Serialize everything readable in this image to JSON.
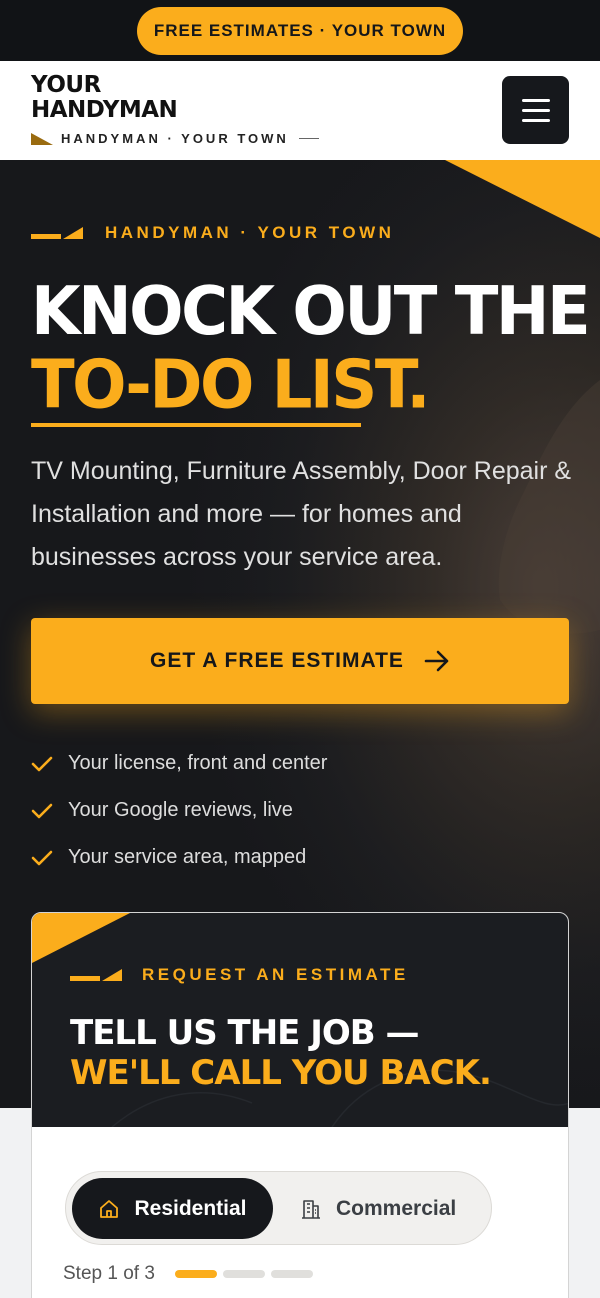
{
  "announcement": {
    "label": "FREE ESTIMATES · YOUR TOWN"
  },
  "brand": {
    "line1": "YOUR",
    "line2": "HANDYMAN",
    "tagline": "HANDYMAN · YOUR TOWN"
  },
  "menu": {
    "icon": "hamburger-menu-icon"
  },
  "hero": {
    "eyebrow": "HANDYMAN · YOUR TOWN",
    "title_line1": "KNOCK OUT THE",
    "title_line2": "TO-DO LIST.",
    "lead": "TV Mounting, Furniture Assembly, Door Repair & Installation and more — for homes and businesses across your service area.",
    "cta_label": "GET A FREE ESTIMATE",
    "checks": [
      "Your license, front and center",
      "Your Google reviews, live",
      "Your service area, mapped"
    ]
  },
  "estimate_card": {
    "eyebrow": "REQUEST AN ESTIMATE",
    "title_line1": "TELL US THE JOB —",
    "title_line2": "WE'LL CALL YOU BACK.",
    "options": [
      "Residential",
      "Commercial"
    ],
    "selected_option": "Residential",
    "step_label": "Step 1 of 3",
    "step_current": 1,
    "step_total": 3
  },
  "colors": {
    "accent": "#fbad1c",
    "dark": "#16181c",
    "white": "#ffffff"
  }
}
